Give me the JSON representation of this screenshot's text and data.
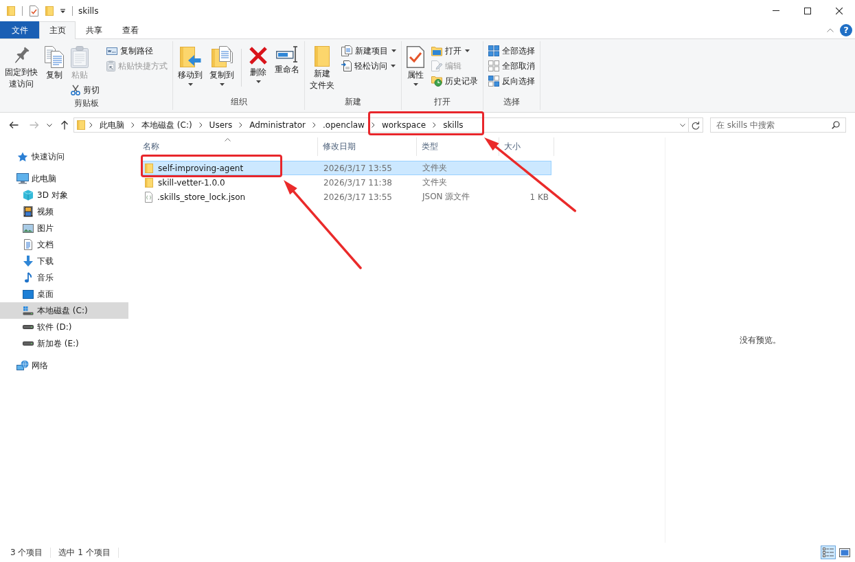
{
  "window": {
    "title": "skills"
  },
  "ribbon_tabs": [
    {
      "label": "文件",
      "kind": "file-menu",
      "selected": false
    },
    {
      "label": "主页",
      "kind": "tab",
      "selected": true
    },
    {
      "label": "共享",
      "kind": "tab",
      "selected": false
    },
    {
      "label": "查看",
      "kind": "tab",
      "selected": false
    }
  ],
  "help_button": {
    "label": "?"
  },
  "ribbon_groups": [
    {
      "label": "剪贴板",
      "columns": [
        {
          "separated": false,
          "items": [
            {
              "kind": "large",
              "label_lines": [
                "固定到快",
                "速访问"
              ],
              "disabled": false,
              "dropdown": false
            }
          ]
        },
        {
          "separated": false,
          "items": [
            {
              "kind": "large",
              "label": "复制",
              "disabled": false,
              "dropdown": false
            }
          ]
        },
        {
          "separated": false,
          "items": [
            {
              "kind": "large",
              "label": "粘贴",
              "disabled": true,
              "dropdown": false
            },
            {
              "kind": "small",
              "label": "剪切",
              "disabled": false,
              "dropdown": false
            }
          ]
        },
        {
          "separated": false,
          "items": [
            {
              "kind": "small",
              "label": "复制路径",
              "disabled": false,
              "dropdown": false
            },
            {
              "kind": "small",
              "label": "粘贴快捷方式",
              "disabled": true,
              "dropdown": false
            }
          ]
        }
      ]
    },
    {
      "label": "组织",
      "columns": [
        {
          "separated": false,
          "items": [
            {
              "kind": "large",
              "label": "移动到",
              "disabled": false,
              "dropdown": true
            }
          ]
        },
        {
          "separated": false,
          "items": [
            {
              "kind": "large",
              "label": "复制到",
              "disabled": false,
              "dropdown": true
            }
          ]
        },
        {
          "separated": true,
          "items": [
            {
              "kind": "large",
              "label": "删除",
              "disabled": false,
              "dropdown": true
            }
          ]
        },
        {
          "separated": false,
          "items": [
            {
              "kind": "large",
              "label": "重命名",
              "disabled": false,
              "dropdown": false
            }
          ]
        }
      ]
    },
    {
      "label": "新建",
      "columns": [
        {
          "separated": false,
          "items": [
            {
              "kind": "large",
              "label_lines": [
                "新建",
                "文件夹"
              ],
              "disabled": false,
              "dropdown": false
            }
          ]
        },
        {
          "separated": false,
          "items": [
            {
              "kind": "small",
              "label": "新建项目",
              "disabled": false,
              "dropdown": true
            },
            {
              "kind": "small",
              "label": "轻松访问",
              "disabled": false,
              "dropdown": true
            }
          ]
        }
      ]
    },
    {
      "label": "打开",
      "columns": [
        {
          "separated": false,
          "items": [
            {
              "kind": "large",
              "label": "属性",
              "disabled": false,
              "dropdown": true
            }
          ]
        },
        {
          "separated": false,
          "items": [
            {
              "kind": "small",
              "label": "打开",
              "disabled": false,
              "dropdown": true
            },
            {
              "kind": "small",
              "label": "编辑",
              "disabled": true,
              "dropdown": false
            },
            {
              "kind": "small",
              "label": "历史记录",
              "disabled": false,
              "dropdown": false
            }
          ]
        }
      ]
    },
    {
      "label": "选择",
      "columns": [
        {
          "separated": false,
          "items": [
            {
              "kind": "small",
              "label": "全部选择",
              "disabled": false,
              "dropdown": false
            },
            {
              "kind": "small",
              "label": "全部取消",
              "disabled": false,
              "dropdown": false
            },
            {
              "kind": "small",
              "label": "反向选择",
              "disabled": false,
              "dropdown": false
            }
          ]
        }
      ]
    }
  ],
  "nav_buttons": [
    {
      "kind": "back",
      "disabled": false
    },
    {
      "kind": "forward",
      "disabled": true
    },
    {
      "kind": "recent",
      "disabled": false
    },
    {
      "kind": "up",
      "disabled": false
    }
  ],
  "address_bar": {
    "crumbs": [
      {
        "label": "此电脑",
        "highlighted": false
      },
      {
        "label": "本地磁盘 (C:)",
        "highlighted": false
      },
      {
        "label": "Users",
        "highlighted": false
      },
      {
        "label": "Administrator",
        "highlighted": false
      },
      {
        "label": ".openclaw",
        "highlighted": false
      },
      {
        "label": "workspace",
        "highlighted": true
      },
      {
        "label": "skills",
        "highlighted": true
      }
    ]
  },
  "search": {
    "placeholder": "在 skills 中搜索"
  },
  "sidebar": {
    "items": [
      {
        "label": "快速访问",
        "selected": false
      },
      {
        "label": "此电脑",
        "selected": false,
        "children": [
          {
            "label": "3D 对象",
            "selected": false
          },
          {
            "label": "视频",
            "selected": false
          },
          {
            "label": "图片",
            "selected": false
          },
          {
            "label": "文档",
            "selected": false
          },
          {
            "label": "下载",
            "selected": false
          },
          {
            "label": "音乐",
            "selected": false
          },
          {
            "label": "桌面",
            "selected": false
          },
          {
            "label": "本地磁盘 (C:)",
            "selected": true
          },
          {
            "label": "软件 (D:)",
            "selected": false
          },
          {
            "label": "新加卷 (E:)",
            "selected": false
          }
        ]
      },
      {
        "label": "网络",
        "selected": false
      }
    ]
  },
  "file_list": {
    "columns": [
      {
        "label": "名称",
        "sorted": true
      },
      {
        "label": "修改日期",
        "sorted": false
      },
      {
        "label": "类型",
        "sorted": false
      },
      {
        "label": "大小",
        "sorted": false
      }
    ],
    "rows": [
      {
        "kind": "folder",
        "name": "self-improving-agent",
        "modified": "2026/3/17 13:55",
        "type": "文件夹",
        "selected": true,
        "highlighted": true
      },
      {
        "kind": "folder",
        "name": "skill-vetter-1.0.0",
        "modified": "2026/3/17 11:38",
        "type": "文件夹",
        "selected": false,
        "highlighted": false
      },
      {
        "kind": "file",
        "name": ".skills_store_lock.json",
        "modified": "2026/3/17 13:55",
        "type": "JSON 源文件",
        "size": "1 KB",
        "selected": false,
        "highlighted": false
      }
    ]
  },
  "preview": {
    "message": "没有预览。"
  },
  "status_bar": {
    "item_count": "3 个项目",
    "selection_count": "选中 1 个项目",
    "view_buttons": [
      {
        "kind": "details",
        "selected": true
      },
      {
        "kind": "large-icons",
        "selected": false
      }
    ]
  }
}
